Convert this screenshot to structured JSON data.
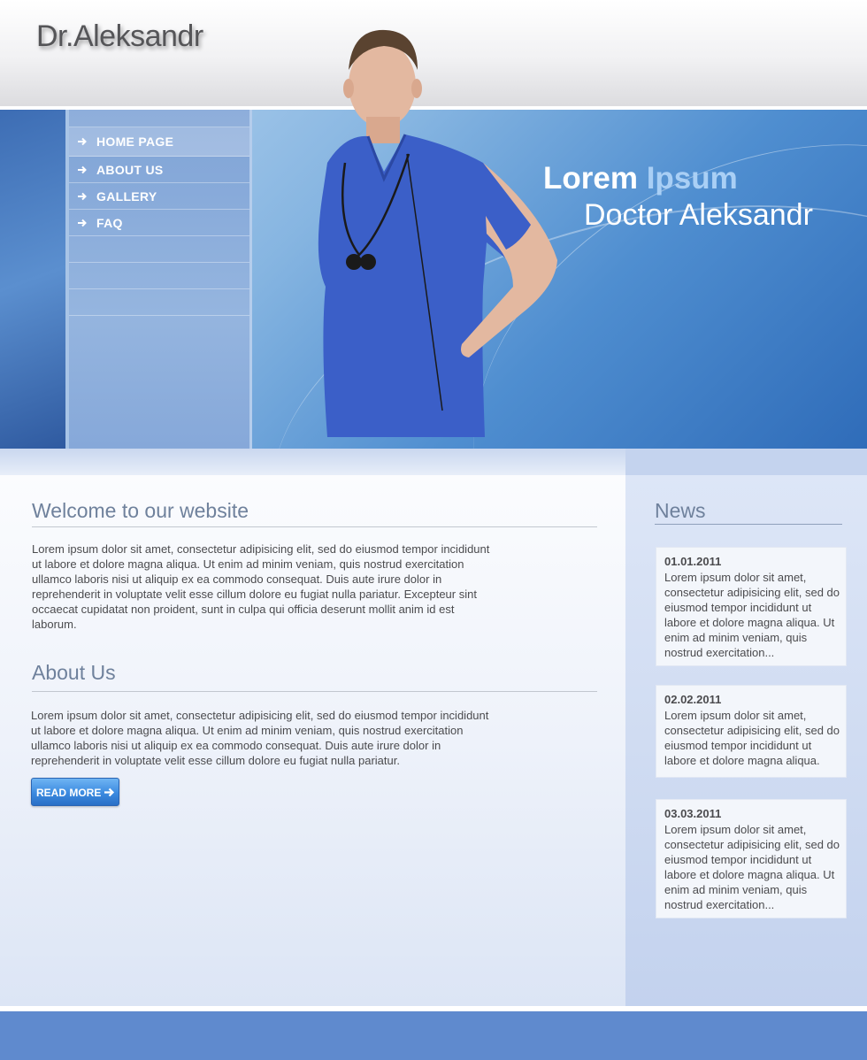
{
  "header": {
    "logo": "Dr.Aleksandr"
  },
  "nav": {
    "items": [
      {
        "label": "HOME PAGE",
        "active": true
      },
      {
        "label": "ABOUT US",
        "active": false
      },
      {
        "label": "GALLERY",
        "active": false
      },
      {
        "label": "FAQ",
        "active": false
      }
    ]
  },
  "banner": {
    "title_word1": "Lorem",
    "title_word2": "Ipsum",
    "subtitle": "Doctor Aleksandr"
  },
  "main": {
    "welcome": {
      "title": "Welcome to our website",
      "text": "Lorem ipsum dolor sit amet, consectetur adipisicing elit, sed do eiusmod tempor incididunt ut labore et dolore magna aliqua. Ut enim ad minim veniam, quis nostrud exercitation ullamco laboris nisi ut aliquip ex ea commodo consequat. Duis aute irure dolor in reprehenderit in voluptate velit esse cillum dolore eu fugiat nulla pariatur. Excepteur sint occaecat cupidatat non proident, sunt in culpa qui officia deserunt mollit anim id est laborum."
    },
    "about": {
      "title": "About Us",
      "text": "Lorem ipsum dolor sit amet, consectetur adipisicing elit, sed do eiusmod tempor incididunt ut labore et dolore magna aliqua. Ut enim ad minim veniam, quis nostrud exercitation ullamco laboris nisi ut aliquip ex ea commodo consequat. Duis aute irure dolor in reprehenderit in voluptate velit esse cillum dolore eu fugiat nulla pariatur.",
      "button_label": "READ MORE"
    }
  },
  "news": {
    "title": "News",
    "items": [
      {
        "date": "01.01.2011",
        "text": "Lorem ipsum dolor sit amet, consectetur adipisicing elit, sed do eiusmod tempor incididunt ut labore et dolore magna aliqua. Ut enim ad minim veniam, quis nostrud exercitation..."
      },
      {
        "date": "02.02.2011",
        "text": "Lorem ipsum dolor sit amet, consectetur adipisicing elit, sed do eiusmod tempor incididunt ut labore et dolore magna aliqua."
      },
      {
        "date": "03.03.2011",
        "text": "Lorem ipsum dolor sit amet, consectetur adipisicing elit, sed do eiusmod tempor incididunt ut labore et dolore magna aliqua. Ut enim ad minim veniam, quis nostrud exercitation..."
      }
    ]
  },
  "colors": {
    "accent": "#a9cff5",
    "heading": "#6f819c",
    "footer": "#5f8ace"
  }
}
